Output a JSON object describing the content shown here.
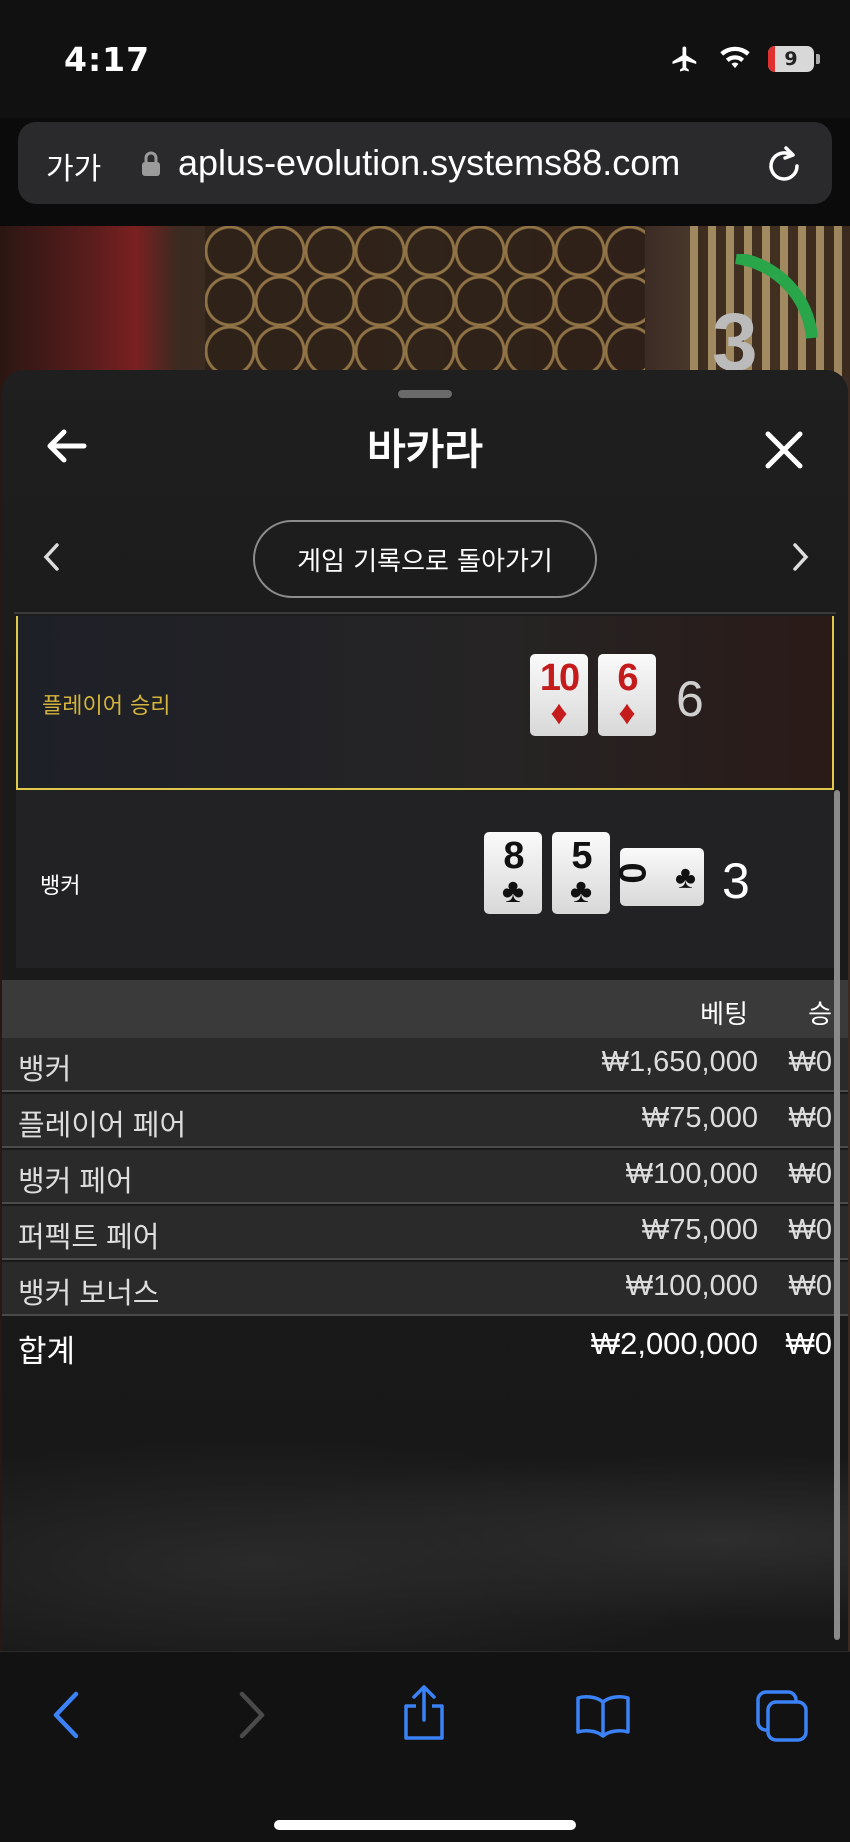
{
  "status_bar": {
    "time": "4:17",
    "battery": "9"
  },
  "url_bar": {
    "text_size_label": "가가",
    "url": "aplus-evolution.systems88.com"
  },
  "background": {
    "timer_number": "3"
  },
  "sheet": {
    "title": "바카라",
    "history_button": "게임 기록으로 돌아가기",
    "player": {
      "label": "플레이어 승리",
      "score": "6",
      "cards": [
        {
          "rank": "10",
          "suit": "♦"
        },
        {
          "rank": "6",
          "suit": "♦"
        }
      ]
    },
    "banker": {
      "label": "뱅커",
      "score": "3",
      "cards": [
        {
          "rank": "8",
          "suit": "♣"
        },
        {
          "rank": "5",
          "suit": "♣"
        },
        {
          "rank": "0",
          "suit": "♣"
        }
      ]
    },
    "bets": {
      "header": {
        "bet": "베팅",
        "win": "승"
      },
      "rows": [
        {
          "name": "뱅커",
          "bet": "₩1,650,000",
          "win": "₩0"
        },
        {
          "name": "플레이어 페어",
          "bet": "₩75,000",
          "win": "₩0"
        },
        {
          "name": "뱅커 페어",
          "bet": "₩100,000",
          "win": "₩0"
        },
        {
          "name": "퍼펙트 페어",
          "bet": "₩75,000",
          "win": "₩0"
        },
        {
          "name": "뱅커 보너스",
          "bet": "₩100,000",
          "win": "₩0"
        }
      ],
      "total": {
        "name": "합계",
        "bet": "₩2,000,000",
        "win": "₩0"
      }
    }
  },
  "colors": {
    "accent_yellow": "#e0c84a",
    "player_label": "#d4b43a",
    "card_red": "#c41c1c",
    "ios_blue": "#3b82f6"
  }
}
